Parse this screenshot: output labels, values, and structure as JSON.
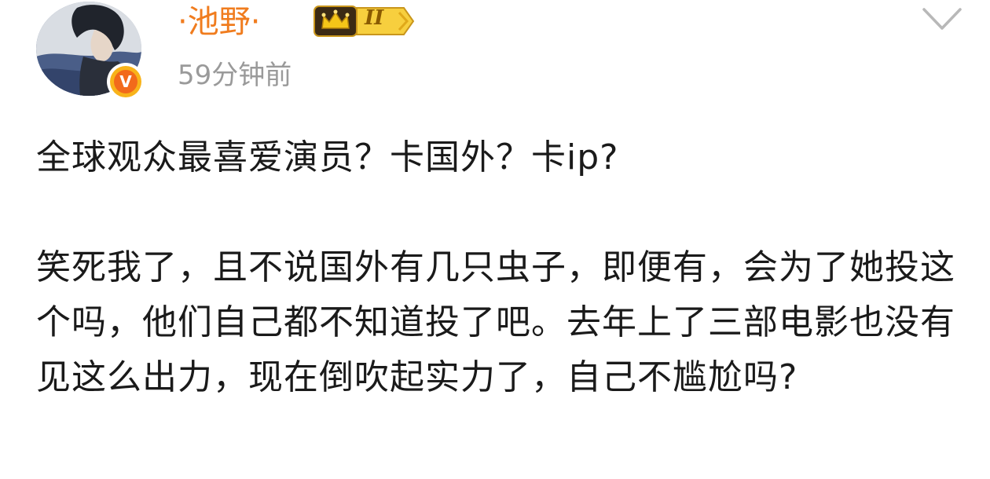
{
  "post": {
    "author": {
      "name": "·池野·",
      "vip_level": "II",
      "verified_mark": "V",
      "avatar_icon": "avatar-photo-icon"
    },
    "timestamp": "59分钟前",
    "menu_icon": "chevron-down-icon",
    "content": {
      "paragraph_1": "全球观众最喜爱演员？卡国外？卡ip?",
      "paragraph_2": "笑死我了，且不说国外有几只虫子，即便有，会为了她投这个吗，他们自己都不知道投了吧。去年上了三部电影也没有见这么出力，现在倒吹起实力了，自己不尴尬吗?"
    },
    "colors": {
      "username": "#f07c1e",
      "timestamp": "#9a9a9a",
      "vip_gold": "#f5c518",
      "verified": "#f26a1b",
      "text": "#1a1a1a"
    }
  }
}
